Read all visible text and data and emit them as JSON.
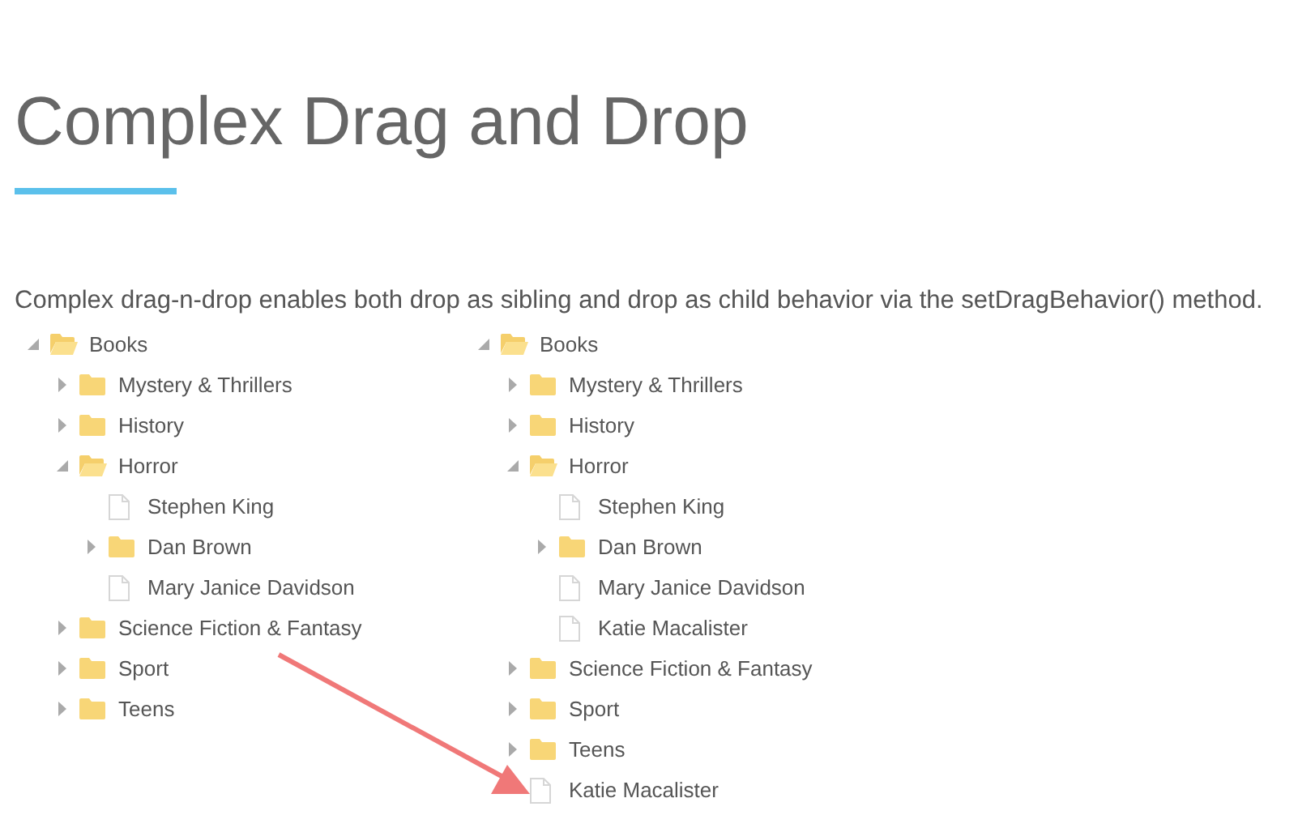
{
  "title": "Complex Drag and Drop",
  "description": "Complex drag-n-drop enables both drop as sibling and drop as child behavior via the setDragBehavior() method.",
  "trees": [
    {
      "nodes": [
        {
          "label": "Books",
          "kind": "folder",
          "expanded": true,
          "children": [
            {
              "label": "Mystery & Thrillers",
              "kind": "folder",
              "expanded": false
            },
            {
              "label": "History",
              "kind": "folder",
              "expanded": false
            },
            {
              "label": "Horror",
              "kind": "folder",
              "expanded": true,
              "children": [
                {
                  "label": "Stephen King",
                  "kind": "file"
                },
                {
                  "label": "Dan Brown",
                  "kind": "folder",
                  "expanded": false
                },
                {
                  "label": "Mary Janice Davidson",
                  "kind": "file"
                }
              ]
            },
            {
              "label": "Science Fiction & Fantasy",
              "kind": "folder",
              "expanded": false
            },
            {
              "label": "Sport",
              "kind": "folder",
              "expanded": false
            },
            {
              "label": "Teens",
              "kind": "folder",
              "expanded": false
            }
          ]
        }
      ]
    },
    {
      "nodes": [
        {
          "label": "Books",
          "kind": "folder",
          "expanded": true,
          "children": [
            {
              "label": "Mystery & Thrillers",
              "kind": "folder",
              "expanded": false
            },
            {
              "label": "History",
              "kind": "folder",
              "expanded": false
            },
            {
              "label": "Horror",
              "kind": "folder",
              "expanded": true,
              "children": [
                {
                  "label": "Stephen King",
                  "kind": "file"
                },
                {
                  "label": "Dan Brown",
                  "kind": "folder",
                  "expanded": false
                },
                {
                  "label": "Mary Janice Davidson",
                  "kind": "file"
                },
                {
                  "label": "Katie Macalister",
                  "kind": "file"
                }
              ]
            },
            {
              "label": "Science Fiction & Fantasy",
              "kind": "folder",
              "expanded": false
            },
            {
              "label": "Sport",
              "kind": "folder",
              "expanded": false
            },
            {
              "label": "Teens",
              "kind": "folder",
              "expanded": false
            },
            {
              "label": "Katie Macalister",
              "kind": "file"
            }
          ]
        }
      ]
    }
  ]
}
